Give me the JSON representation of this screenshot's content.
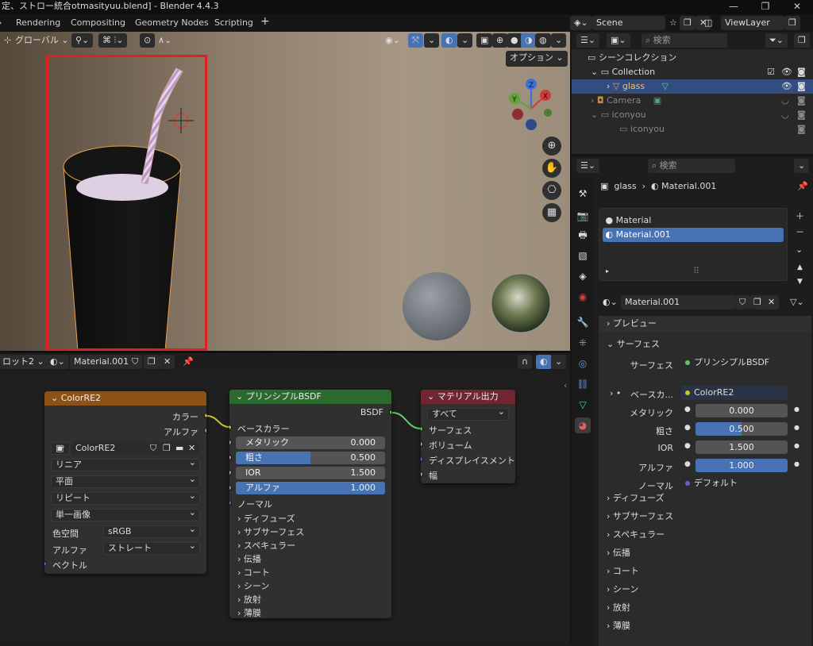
{
  "window": {
    "title": "定、ストロー統合otmasityuu.blend] - Blender 4.4.3"
  },
  "workspace_tabs": [
    "Rendering",
    "Compositing",
    "Geometry Nodes",
    "Scripting",
    "+"
  ],
  "viewport": {
    "transform_orientation": "グローバル",
    "options_label": "オプション",
    "gizmo_axes": [
      "Z",
      "Y",
      "X"
    ]
  },
  "node_editor": {
    "slot": "ロット2",
    "material_name": "Material.001",
    "image_node": {
      "title": "ColorRE2",
      "outputs": [
        "カラー",
        "アルファ"
      ],
      "image_name": "ColorRE2",
      "interpolation": "リニア",
      "projection": "平面",
      "extension": "リピート",
      "source": "単一画像",
      "colorspace_label": "色空間",
      "colorspace": "sRGB",
      "alpha_label": "アルファ",
      "alpha_mode": "ストレート",
      "vector_label": "ベクトル"
    },
    "bsdf_node": {
      "title": "プリンシプルBSDF",
      "output": "BSDF",
      "base_color": "ベースカラー",
      "fields": [
        {
          "label": "メタリック",
          "value": "0.000",
          "fill": 0
        },
        {
          "label": "粗さ",
          "value": "0.500",
          "fill": 0.5
        },
        {
          "label": "IOR",
          "value": "1.500",
          "fill": 0
        },
        {
          "label": "アルファ",
          "value": "1.000",
          "fill": 1
        }
      ],
      "normal": "ノーマル",
      "panels": [
        "ディフューズ",
        "サブサーフェス",
        "スペキュラー",
        "伝播",
        "コート",
        "シーン",
        "放射",
        "薄膜"
      ]
    },
    "output_node": {
      "title": "マテリアル出力",
      "target": "すべて",
      "inputs": [
        "サーフェス",
        "ボリューム",
        "ディスプレイスメント",
        "幅"
      ]
    }
  },
  "topbar_right": {
    "scene": "Scene",
    "view_layer": "ViewLayer"
  },
  "outliner": {
    "search_placeholder": "検索",
    "scene_collection": "シーンコレクション",
    "rows": [
      {
        "name": "Collection"
      },
      {
        "name": "glass"
      },
      {
        "name": "Camera"
      },
      {
        "name": "iconyou"
      },
      {
        "name": "iconyou"
      }
    ]
  },
  "properties": {
    "search_placeholder": "検索",
    "breadcrumb": [
      "glass",
      "Material.001"
    ],
    "slots": [
      "Material",
      "Material.001"
    ],
    "material_name": "Material.001",
    "preview_label": "プレビュー",
    "surface_section": "サーフェス",
    "surface_label": "サーフェス",
    "surface_value": "プリンシプルBSDF",
    "base_color_label": "ベースカ...",
    "base_color_value": "ColorRE2",
    "fields": [
      {
        "label": "メタリック",
        "value": "0.000",
        "fill": 0
      },
      {
        "label": "粗さ",
        "value": "0.500",
        "fill": 0.5
      },
      {
        "label": "IOR",
        "value": "1.500",
        "fill": 0
      },
      {
        "label": "アルファ",
        "value": "1.000",
        "fill": 1
      }
    ],
    "normal_label": "ノーマル",
    "normal_value": "デフォルト",
    "panels": [
      "ディフューズ",
      "サブサーフェス",
      "スペキュラー",
      "伝播",
      "コート",
      "シーン",
      "放射",
      "薄膜"
    ]
  },
  "colors": {
    "accent": "#4772b3",
    "highlight": "#e0201e",
    "image_node_header": "#8c5218",
    "bsdf_header": "#2b6a2d",
    "output_header": "#6f2631"
  }
}
